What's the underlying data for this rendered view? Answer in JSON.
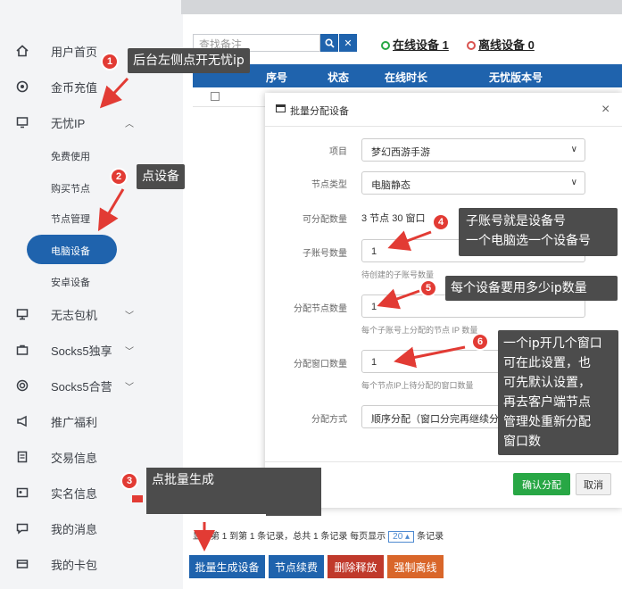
{
  "sidebar": {
    "items": [
      {
        "label": "用户首页",
        "icon": "home-icon"
      },
      {
        "label": "金币充值",
        "icon": "coin-icon"
      },
      {
        "label": "无忧IP",
        "icon": "monitor-icon"
      },
      {
        "label": "无志包机",
        "icon": "desktop-icon"
      },
      {
        "label": "Socks5独享",
        "icon": "briefcase-icon"
      },
      {
        "label": "Socks5合营",
        "icon": "target-icon"
      },
      {
        "label": "推广福利",
        "icon": "megaphone-icon"
      },
      {
        "label": "交易信息",
        "icon": "document-icon"
      },
      {
        "label": "实名信息",
        "icon": "id-card-icon"
      },
      {
        "label": "我的消息",
        "icon": "message-icon"
      },
      {
        "label": "我的卡包",
        "icon": "card-icon"
      }
    ],
    "subitems": [
      "免费使用",
      "购买节点",
      "节点管理",
      "电脑设备",
      "安卓设备"
    ]
  },
  "toolbar": {
    "search_placeholder": "查找备注",
    "online_label": "在线设备 1",
    "offline_label": "离线设备 0"
  },
  "table": {
    "headers": [
      "序号",
      "状态",
      "在线时长",
      "无忧版本号"
    ]
  },
  "pager": {
    "text_before": "显示第 1 到第 1 条记录，总共 1 条记录  每页显示",
    "page_size": "20",
    "text_after": "条记录"
  },
  "buttons": {
    "batch": "批量生成设备",
    "renew": "节点续费",
    "release": "删除释放",
    "offline": "强制离线"
  },
  "colors": {
    "primary": "#1f63ad",
    "green": "#28a745",
    "red": "#c0392b",
    "orange": "#d9662a"
  },
  "modal": {
    "title": "批量分配设备",
    "project_label": "项目",
    "project_value": "梦幻西游手游",
    "node_type_label": "节点类型",
    "node_type_value": "电脑静态",
    "available_label": "可分配数量",
    "available_value": "3 节点 30 窗口",
    "sub_label": "子账号数量",
    "sub_value": "1",
    "sub_help": "待创建的子账号数量",
    "node_label": "分配节点数量",
    "node_value": "1",
    "node_help": "每个子账号上分配的节点 IP 数量",
    "window_label": "分配窗口数量",
    "window_value": "1",
    "window_help": "每个节点IP上待分配的窗口数量",
    "method_label": "分配方式",
    "method_value": "顺序分配（窗口分完再继续分",
    "confirm": "确认分配",
    "cancel": "取消"
  },
  "annotations": {
    "n1": "后台左侧点开无忧ip",
    "n2": "点设备",
    "n3": "点批量生成",
    "n4a": "子账号就是设备号",
    "n4b": "一个电脑选一个设备号",
    "n5": "每个设备要用多少ip数量",
    "n6": [
      "一个ip开几个窗口",
      "可在此设置，也",
      "可先默认设置，",
      "再去客户端节点",
      "管理处重新分配",
      "窗口数"
    ]
  }
}
